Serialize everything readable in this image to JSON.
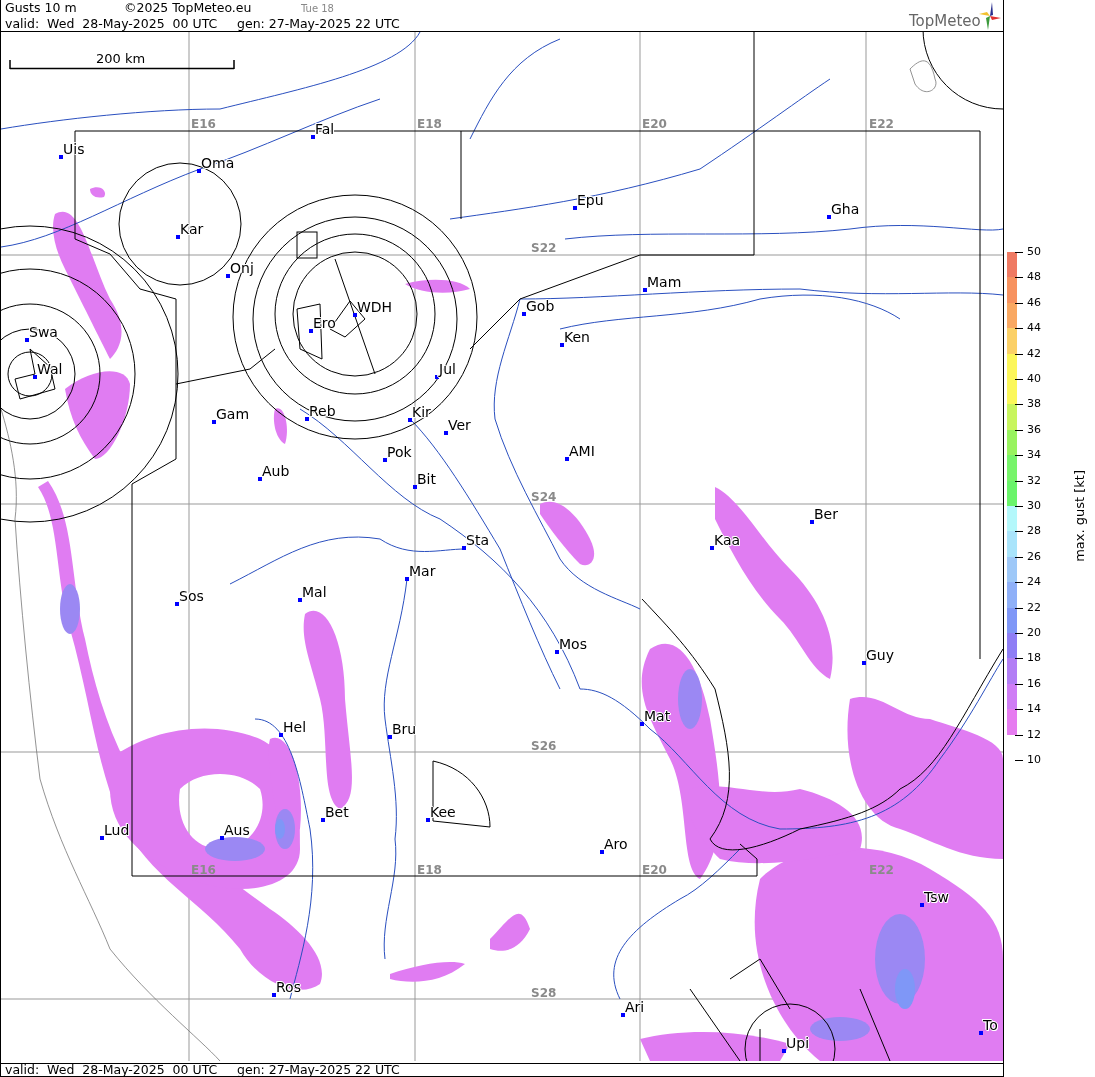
{
  "header": {
    "title": "Gusts 10 m",
    "copyright": "©2025 TopMeteo.eu",
    "day": "Tue 18",
    "valid": "valid:  Wed  28-May-2025  00 UTC",
    "generated": "gen: 27-May-2025 22 UTC"
  },
  "logo": {
    "text": "TopMeteo"
  },
  "scale_bar": {
    "label": "200 km"
  },
  "grid_labels": [
    "E16",
    "E18",
    "E20",
    "E22",
    "S22",
    "S24",
    "S26",
    "S28",
    "E16",
    "E18",
    "E20",
    "E22"
  ],
  "stations": [
    "Uis",
    "Fal",
    "Oma",
    "Kar",
    "Onj",
    "Swa",
    "Wal",
    "Ero",
    "WDH",
    "Jul",
    "Gam",
    "Reb",
    "Kir",
    "Ver",
    "Pok",
    "Bit",
    "Aub",
    "Epu",
    "Gha",
    "Mam",
    "Gob",
    "Ken",
    "AMI",
    "Sta",
    "Mar",
    "Sos",
    "Mal",
    "Mos",
    "Kaa",
    "Ber",
    "Guy",
    "Mat",
    "Hel",
    "Bru",
    "Bet",
    "Kee",
    "Lud",
    "Aus",
    "Aro",
    "Tsw",
    "Ros",
    "Ari",
    "Upi",
    "To"
  ],
  "legend": {
    "title": "max. gust [kt]",
    "ticks": [
      "50",
      "48",
      "46",
      "44",
      "42",
      "40",
      "38",
      "36",
      "34",
      "32",
      "30",
      "28",
      "26",
      "24",
      "22",
      "20",
      "18",
      "16",
      "14",
      "12",
      "10"
    ],
    "segments": [
      {
        "color": "#ef7a63"
      },
      {
        "color": "#f7925f"
      },
      {
        "color": "#f9a862"
      },
      {
        "color": "#fbd067"
      },
      {
        "color": "#fcf65a"
      },
      {
        "color": "#fbf75a"
      },
      {
        "color": "#c8f55e"
      },
      {
        "color": "#99f35f"
      },
      {
        "color": "#77f46a"
      },
      {
        "color": "#6af46a"
      },
      {
        "color": "#b4f8fb"
      },
      {
        "color": "#a9e4fb"
      },
      {
        "color": "#9ec8f8"
      },
      {
        "color": "#8fb0f8"
      },
      {
        "color": "#7f97f7"
      },
      {
        "color": "#8f7ef5"
      },
      {
        "color": "#b27ef5"
      },
      {
        "color": "#cf7df5"
      },
      {
        "color": "#e67cf0"
      }
    ]
  },
  "footer": {
    "valid": "valid:  Wed  28-May-2025  00 UTC",
    "generated": "gen: 27-May-2025 22 UTC"
  }
}
